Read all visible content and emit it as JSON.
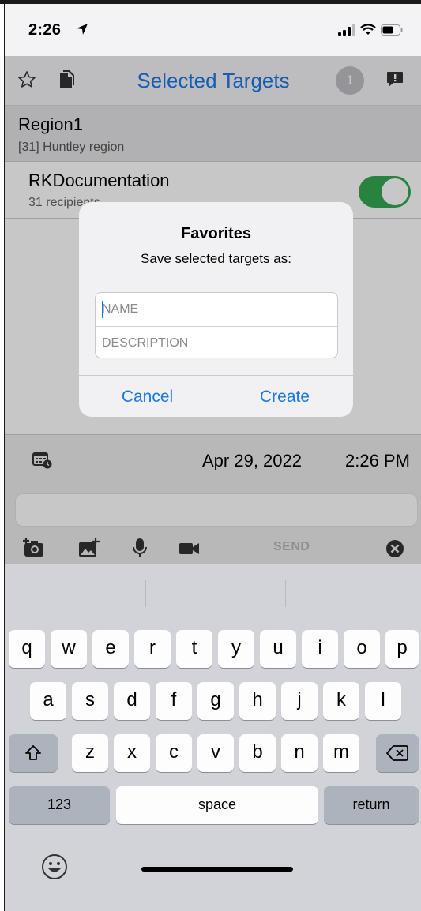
{
  "status_bar": {
    "time": "2:26"
  },
  "nav": {
    "title": "Selected Targets",
    "badge_count": "1"
  },
  "section": {
    "title": "Region1",
    "subtitle": "[31] Huntley region"
  },
  "item": {
    "title": "RKDocumentation",
    "subtitle": "31 recipients",
    "toggle_on": true
  },
  "schedule": {
    "date": "Apr 29, 2022",
    "time": "2:26 PM"
  },
  "compose": {
    "send_label": "SEND"
  },
  "dialog": {
    "title": "Favorites",
    "message": "Save selected targets as:",
    "name_placeholder": "NAME",
    "description_placeholder": "DESCRIPTION",
    "cancel_label": "Cancel",
    "create_label": "Create"
  },
  "keyboard": {
    "row1": [
      "q",
      "w",
      "e",
      "r",
      "t",
      "y",
      "u",
      "i",
      "o",
      "p"
    ],
    "row2": [
      "a",
      "s",
      "d",
      "f",
      "g",
      "h",
      "j",
      "k",
      "l"
    ],
    "row3": [
      "z",
      "x",
      "c",
      "v",
      "b",
      "n",
      "m"
    ],
    "numbers_label": "123",
    "space_label": "space",
    "return_label": "return"
  },
  "colors": {
    "accent": "#1a78e6",
    "toggle_on": "#34a853"
  }
}
